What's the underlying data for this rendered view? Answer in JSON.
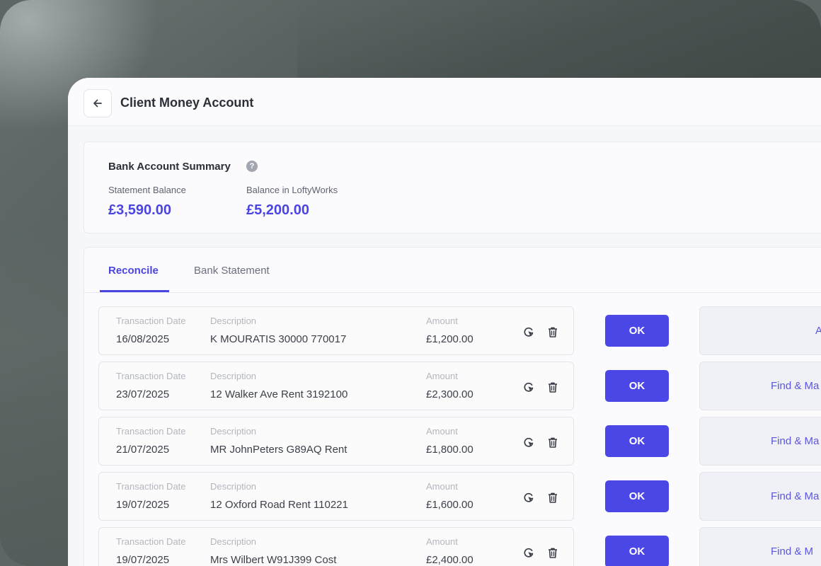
{
  "header": {
    "back_label": "←",
    "title": "Client Money Account"
  },
  "summary": {
    "title": "Bank Account Summary",
    "help": "?",
    "statement_label": "Statement Balance",
    "statement_value": "£3,590.00",
    "lofty_label": "Balance in LoftyWorks",
    "lofty_value": "£5,200.00"
  },
  "tabs": [
    {
      "label": "Reconcile",
      "active": true
    },
    {
      "label": "Bank Statement",
      "active": false
    }
  ],
  "columns": {
    "date": "Transaction Date",
    "description": "Description",
    "amount": "Amount"
  },
  "transactions": [
    {
      "date": "16/08/2025",
      "description": "K MOURATIS 30000 770017",
      "amount": "£1,200.00",
      "ok": "OK",
      "match": "A"
    },
    {
      "date": "23/07/2025",
      "description": "12 Walker Ave Rent 3192100",
      "amount": "£2,300.00",
      "ok": "OK",
      "match": "Find & Ma"
    },
    {
      "date": "21/07/2025",
      "description": "MR JohnPeters G89AQ Rent",
      "amount": "£1,800.00",
      "ok": "OK",
      "match": "Find & Ma"
    },
    {
      "date": "19/07/2025",
      "description": "12 Oxford Road Rent 110221",
      "amount": "£1,600.00",
      "ok": "OK",
      "match": "Find & Ma"
    },
    {
      "date": "19/07/2025",
      "description": "Mrs Wilbert W91J399 Cost",
      "amount": "£2,400.00",
      "ok": "OK",
      "match": "Find & M"
    }
  ],
  "colors": {
    "accent": "#4b46e6",
    "balance": "#4a45e0"
  },
  "icons": {
    "back": "arrow-left-icon",
    "help": "question-circle-icon",
    "undo": "rotate-cursor-icon",
    "delete": "trash-icon"
  }
}
